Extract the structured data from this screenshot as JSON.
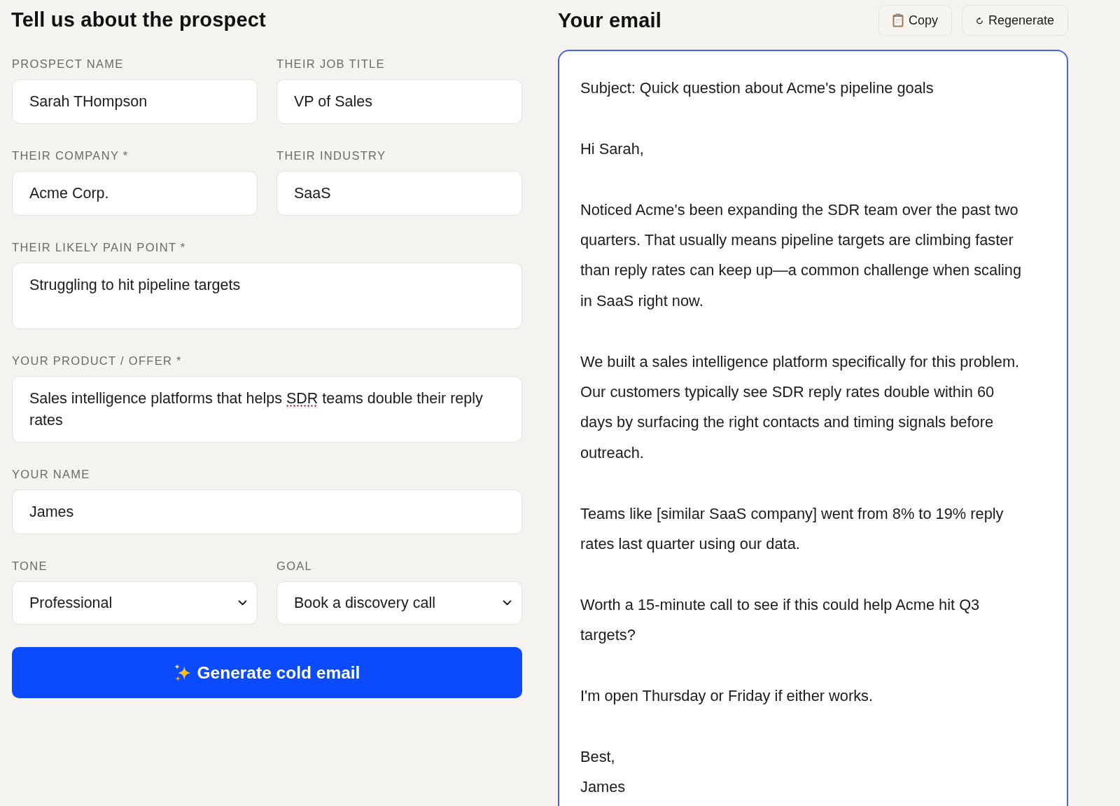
{
  "form": {
    "title": "Tell us about the prospect",
    "rows": [
      [
        {
          "kind": "input",
          "label": "PROSPECT NAME",
          "value": "Sarah THompson"
        },
        {
          "kind": "input",
          "label": "THEIR JOB TITLE",
          "value": "VP of Sales"
        }
      ],
      [
        {
          "kind": "input",
          "label": "THEIR COMPANY *",
          "value": "Acme Corp."
        },
        {
          "kind": "input",
          "label": "THEIR INDUSTRY",
          "value": "SaaS"
        }
      ],
      [
        {
          "kind": "textarea",
          "label": "THEIR LIKELY PAIN POINT *",
          "parts": [
            {
              "text": "Struggling to hit pipeline targets",
              "misspelled": false
            }
          ]
        }
      ],
      [
        {
          "kind": "textarea",
          "label": "YOUR PRODUCT / OFFER *",
          "parts": [
            {
              "text": "Sales intelligence platforms that helps ",
              "misspelled": false
            },
            {
              "text": "SDR",
              "misspelled": true
            },
            {
              "text": " teams double their reply rates",
              "misspelled": false
            }
          ]
        }
      ],
      [
        {
          "kind": "input",
          "label": "YOUR NAME",
          "value": "James"
        }
      ],
      [
        {
          "kind": "select",
          "label": "TONE",
          "value": "Professional"
        },
        {
          "kind": "select",
          "label": "GOAL",
          "value": "Book a discovery call"
        }
      ]
    ],
    "submit": {
      "label": "Generate cold email"
    }
  },
  "email": {
    "title": "Your email",
    "actions": [
      {
        "kind": "copy",
        "label": "Copy"
      },
      {
        "kind": "regenerate",
        "label": "Regenerate"
      }
    ],
    "focused": true,
    "subject": "Subject: Quick question about Acme's pipeline goals",
    "greeting": "Hi Sarah,",
    "paragraphs": [
      "Noticed Acme's been expanding the SDR team over the past two quarters. That usually means pipeline targets are climbing faster than reply rates can keep up—a common challenge when scaling in SaaS right now.",
      "We built a sales intelligence platform specifically for this problem. Our customers typically see SDR reply rates double within 60 days by surfacing the right contacts and timing signals before outreach.",
      "Teams like [similar SaaS company] went from 8% to 19% reply rates last quarter using our data.",
      "Worth a 15-minute call to see if this could help Acme hit Q3 targets?",
      "I'm open Thursday or Friday if either works."
    ],
    "closing": "Best,",
    "signature": "James"
  }
}
